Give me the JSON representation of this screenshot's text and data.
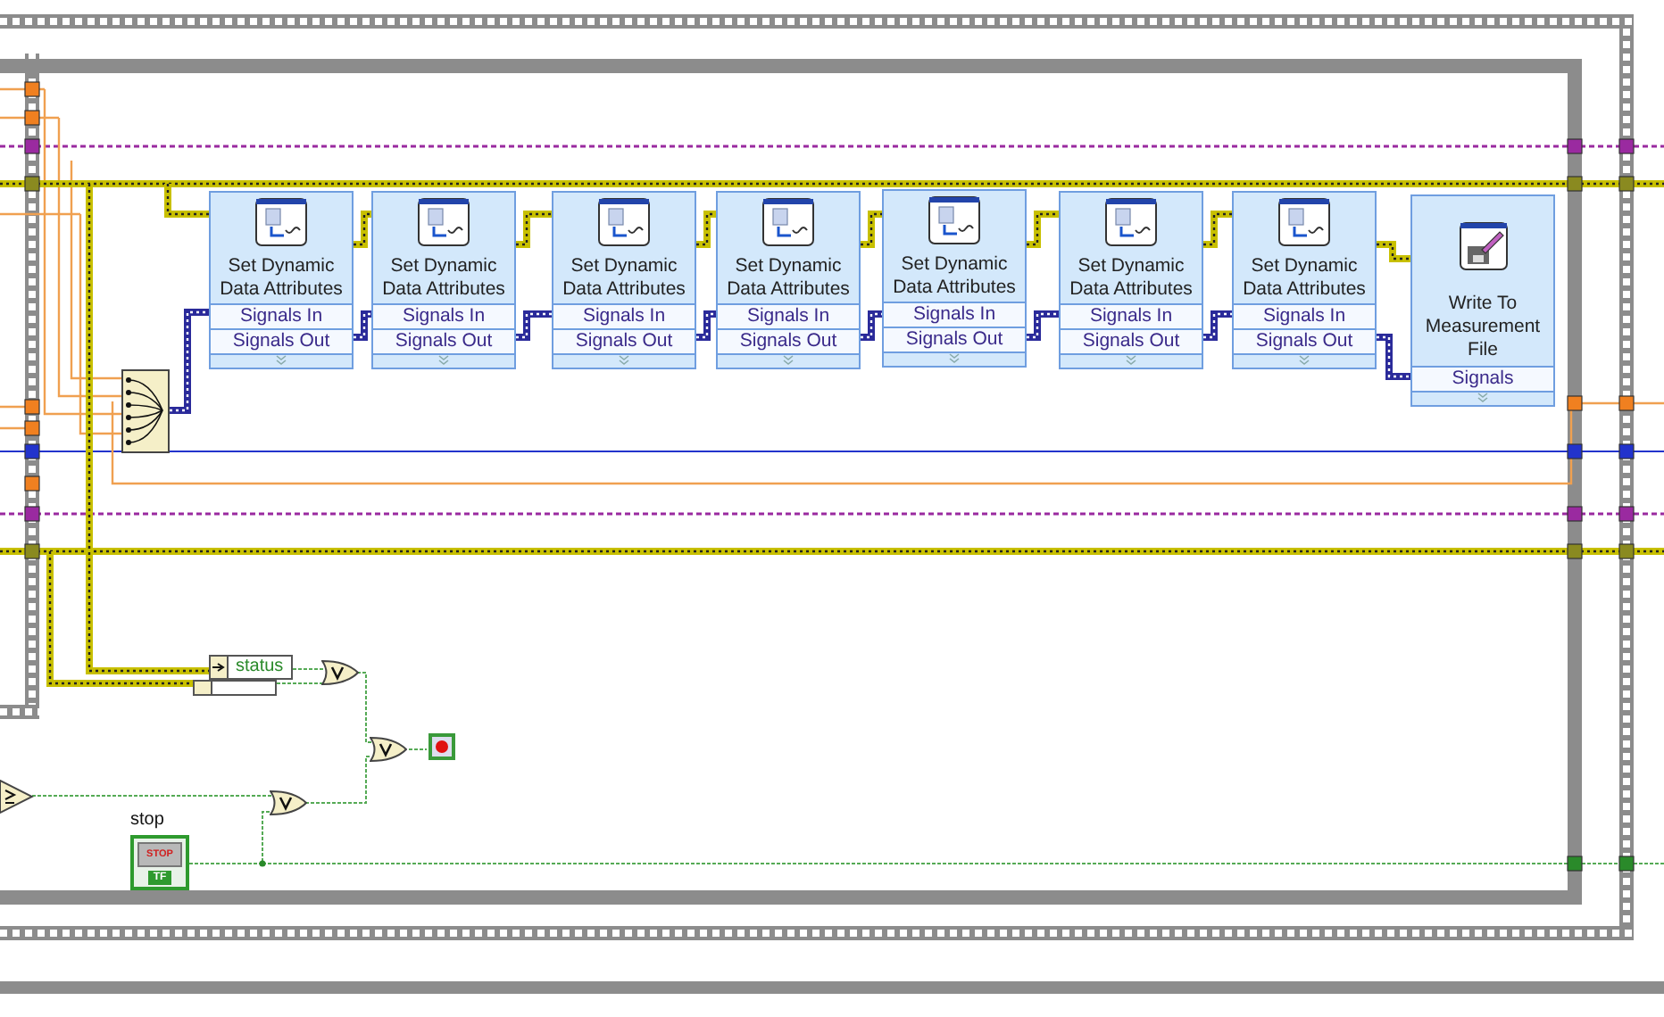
{
  "nodes": [
    {
      "kind": "attributes",
      "title_lines": [
        "Set Dynamic",
        "Data Attributes"
      ],
      "input": "Signals In",
      "output": "Signals Out"
    },
    {
      "kind": "attributes",
      "title_lines": [
        "Set Dynamic",
        "Data Attributes"
      ],
      "input": "Signals In",
      "output": "Signals Out"
    },
    {
      "kind": "attributes",
      "title_lines": [
        "Set Dynamic",
        "Data Attributes"
      ],
      "input": "Signals In",
      "output": "Signals Out"
    },
    {
      "kind": "attributes",
      "title_lines": [
        "Set Dynamic",
        "Data Attributes"
      ],
      "input": "Signals In",
      "output": "Signals Out"
    },
    {
      "kind": "attributes",
      "title_lines": [
        "Set Dynamic",
        "Data Attributes"
      ],
      "input": "Signals In",
      "output": "Signals Out"
    },
    {
      "kind": "attributes",
      "title_lines": [
        "Set Dynamic",
        "Data Attributes"
      ],
      "input": "Signals In",
      "output": "Signals Out"
    },
    {
      "kind": "attributes",
      "title_lines": [
        "Set Dynamic",
        "Data Attributes"
      ],
      "input": "Signals In",
      "output": "Signals Out"
    },
    {
      "kind": "write_file",
      "title_lines": [
        "Write To",
        "Measurement",
        "File"
      ],
      "input": "Signals"
    }
  ],
  "status_unbundle": {
    "label": "status"
  },
  "stop_control": {
    "label": "stop",
    "button_text": "STOP",
    "terminal_text": "TF"
  }
}
